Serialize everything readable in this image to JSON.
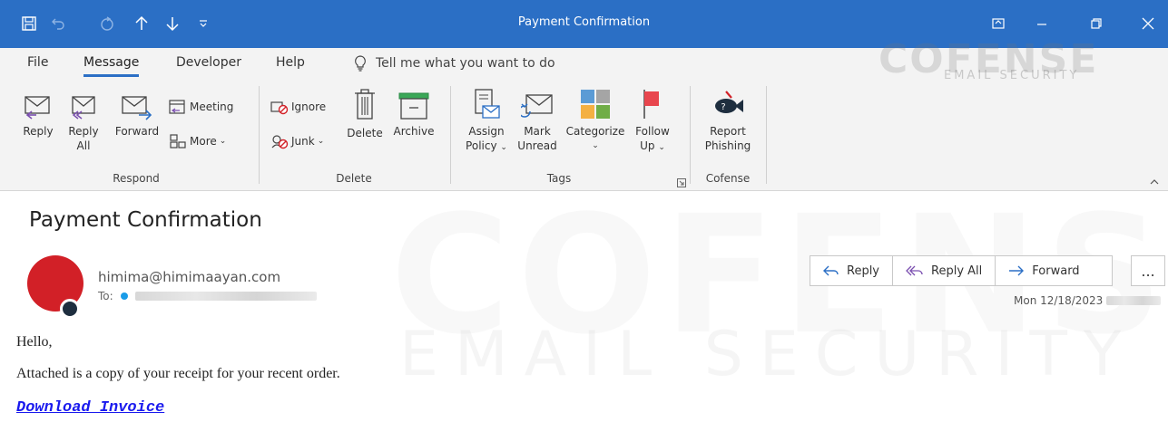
{
  "window": {
    "title": "Payment Confirmation",
    "qat_icons": [
      "save-icon",
      "undo-icon",
      "redo-icon",
      "up-arrow-icon",
      "down-arrow-icon",
      "customize-icon"
    ],
    "controls": [
      "ribbon-display-icon",
      "minimize-icon",
      "restore-icon",
      "close-icon"
    ]
  },
  "menu": {
    "items": [
      "File",
      "Message",
      "Developer",
      "Help"
    ],
    "active": "Message",
    "tell_me": "Tell me what you want to do"
  },
  "ribbon": {
    "respond": {
      "label": "Respond",
      "reply": "Reply",
      "reply_all_1": "Reply",
      "reply_all_2": "All",
      "forward": "Forward",
      "meeting": "Meeting",
      "more": "More"
    },
    "delete": {
      "label": "Delete",
      "ignore": "Ignore",
      "junk": "Junk",
      "delete": "Delete",
      "archive": "Archive"
    },
    "tags": {
      "label": "Tags",
      "assign_1": "Assign",
      "assign_2": "Policy",
      "mark_1": "Mark",
      "mark_2": "Unread",
      "categorize": "Categorize",
      "follow_1": "Follow",
      "follow_2": "Up"
    },
    "cofense": {
      "label": "Cofense",
      "report_1": "Report",
      "report_2": "Phishing"
    }
  },
  "watermark": {
    "logo": "COFENSE",
    "sub": "EMAIL SECURITY",
    "big": "COFENSE",
    "big_sub": "EMAIL SECURITY"
  },
  "message": {
    "subject": "Payment Confirmation",
    "sender": "himima@himimaayan.com",
    "to_label": "To:",
    "date": "Mon 12/18/2023",
    "actions": {
      "reply": "Reply",
      "reply_all": "Reply All",
      "forward": "Forward",
      "more": "..."
    },
    "body": {
      "greeting": "Hello,",
      "line1": "Attached is a copy of your receipt for your recent order.",
      "link": "Download Invoice"
    }
  },
  "colors": {
    "titlebar": "#2b6fc5",
    "avatar": "#d22027",
    "link": "#1a1aee"
  }
}
